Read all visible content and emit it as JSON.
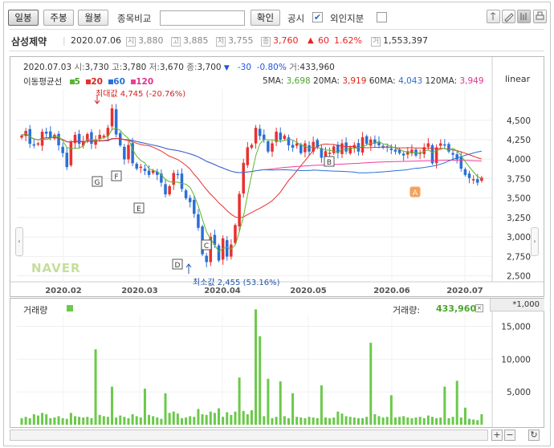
{
  "toolbar": {
    "tabs": [
      "일봉",
      "주봉",
      "월봉"
    ],
    "compare_label": "종목비교",
    "compare_value": "",
    "confirm_label": "확인",
    "disclosure_label": "공시",
    "disclosure_checked": true,
    "foreign_label": "외인지분",
    "foreign_checked": false
  },
  "stock": {
    "name": "삼성제약",
    "date": "2020.07.06",
    "open": "3,880",
    "high": "3,885",
    "low": "3,755",
    "close": "3,760",
    "change_arrow": "▲",
    "change": "60",
    "change_pct": "1.62%",
    "volume": "1,553,397",
    "icons": {
      "open": "시",
      "high": "고",
      "low": "저",
      "close": "종",
      "volume": "거"
    }
  },
  "info_line": {
    "date": "2020.07.03",
    "open_label": "시:",
    "open": "3,730",
    "high_label": "고:",
    "high": "3,780",
    "low_label": "저:",
    "low": "3,670",
    "close_label": "종:",
    "close": "3,700",
    "arrow": "▼",
    "change": "-30",
    "change_pct": "-0.80%",
    "vol_label": "거:",
    "volume": "433,960"
  },
  "ma_legend": {
    "title": "이동평균선",
    "items": [
      {
        "label": "5",
        "color": "#5cb531"
      },
      {
        "label": "20",
        "color": "#e8312f"
      },
      {
        "label": "60",
        "color": "#2b6fd6"
      },
      {
        "label": "120",
        "color": "#f03c9b"
      }
    ]
  },
  "ma_values": [
    {
      "label": "5MA:",
      "value": "3,698",
      "color": "#4aa52a"
    },
    {
      "label": "20MA:",
      "value": "3,919",
      "color": "#d9261c"
    },
    {
      "label": "60MA:",
      "value": "4,043",
      "color": "#2b6fd6"
    },
    {
      "label": "120MA:",
      "value": "3,949",
      "color": "#e0338c"
    }
  ],
  "scale_label": "linear",
  "max_label": "최대값 4,745 (-20.76%)",
  "min_label": "최소값 2,455 (53.16%)",
  "watermark": "NAVER",
  "volume_panel": {
    "title": "거래량",
    "label": "거래량:",
    "value": "433,960",
    "multiplier": "*1,000"
  },
  "chart_data": [
    {
      "type": "candlestick",
      "ylim": [
        2300,
        4900
      ],
      "yticks": [
        "4,500",
        "4,250",
        "4,000",
        "3,750",
        "3,500",
        "3,250",
        "3,000",
        "2,750",
        "2,500"
      ],
      "ytick_values": [
        4500,
        4250,
        4000,
        3750,
        3500,
        3250,
        3000,
        2750,
        2500
      ],
      "xticks": [
        "2020.02",
        "2020.03",
        "2020.04",
        "2020.05",
        "2020.06",
        "2020.07"
      ],
      "markers": [
        "G",
        "F",
        "E",
        "D",
        "C",
        "B",
        "A"
      ],
      "closes": [
        4300,
        4360,
        4200,
        4180,
        4200,
        4350,
        4330,
        4280,
        4310,
        4180,
        4080,
        3900,
        4220,
        4310,
        4200,
        4230,
        4320,
        4200,
        4250,
        4310,
        4300,
        4400,
        4650,
        4320,
        4180,
        4000,
        4180,
        3950,
        3880,
        3900,
        3850,
        3800,
        3850,
        3800,
        3700,
        3550,
        3650,
        3820,
        3800,
        3620,
        3500,
        3450,
        3300,
        3120,
        2780,
        2680,
        3000,
        2900,
        2700,
        2980,
        2750,
        2900,
        3150,
        3550,
        3950,
        4150,
        4180,
        4400,
        4300,
        4250,
        4100,
        4200,
        4350,
        4250,
        4300,
        4180,
        4150,
        4200,
        4080,
        4200,
        4100,
        4220,
        4150,
        4020,
        4100,
        4080,
        4160,
        4080,
        4200,
        4100,
        4150,
        4180,
        4100,
        4280,
        4200,
        4250,
        4200,
        4180,
        4150,
        4160,
        4120,
        4100,
        4080,
        4050,
        4100,
        4120,
        4050,
        4080,
        4150,
        4200,
        3950,
        4150,
        4200,
        4180,
        4100,
        4060,
        4000,
        3880,
        3800,
        3760,
        3740,
        3700,
        3760
      ]
    },
    {
      "type": "bar",
      "title": "거래량",
      "ylim": [
        0,
        18000
      ],
      "yticks": [
        "15,000",
        "10,000",
        "5,000"
      ],
      "ytick_values": [
        15000,
        10000,
        5000
      ],
      "values": [
        1000,
        1200,
        1000,
        1600,
        1400,
        1800,
        1600,
        1000,
        1100,
        1300,
        1000,
        900,
        1800,
        1300,
        1200,
        1100,
        1200,
        1000,
        11500,
        1500,
        1300,
        1200,
        1600,
        1100,
        1400,
        1200,
        1000,
        1600,
        1300,
        1100,
        1200,
        1500,
        1300,
        1100,
        900,
        1100,
        1800,
        2000,
        1700,
        1000,
        1100,
        1300,
        1200,
        2400,
        1600,
        1500,
        2000,
        1800,
        2500,
        1200,
        1900,
        1500,
        2000,
        1800,
        2100,
        1600,
        2200,
        1500,
        1800,
        1300,
        1200,
        1000,
        1200,
        1100,
        1300,
        1000,
        1100,
        1200,
        1100,
        1000,
        1200,
        1100,
        1000,
        1200,
        1100,
        1000,
        1100,
        2000,
        1700,
        1300,
        1200,
        1100,
        1000,
        1000,
        1200,
        1100,
        1600,
        1300,
        1100,
        1200,
        1000,
        1100,
        1200,
        1300,
        1100,
        1000,
        1100,
        1200,
        1000,
        1400,
        1200,
        1000,
        1100,
        900,
        1000,
        1200,
        1300,
        1100,
        1000,
        900,
        800,
        700,
        1600
      ],
      "spikes": {
        "22": 5800,
        "30": 5500,
        "35": 4800,
        "53": 7200,
        "57": 17600,
        "58": 13500,
        "60": 7000,
        "63": 6600,
        "66": 4800,
        "73": 6000,
        "85": 12500,
        "90": 4500,
        "103": 5800,
        "106": 6700,
        "108": 2600
      }
    }
  ]
}
